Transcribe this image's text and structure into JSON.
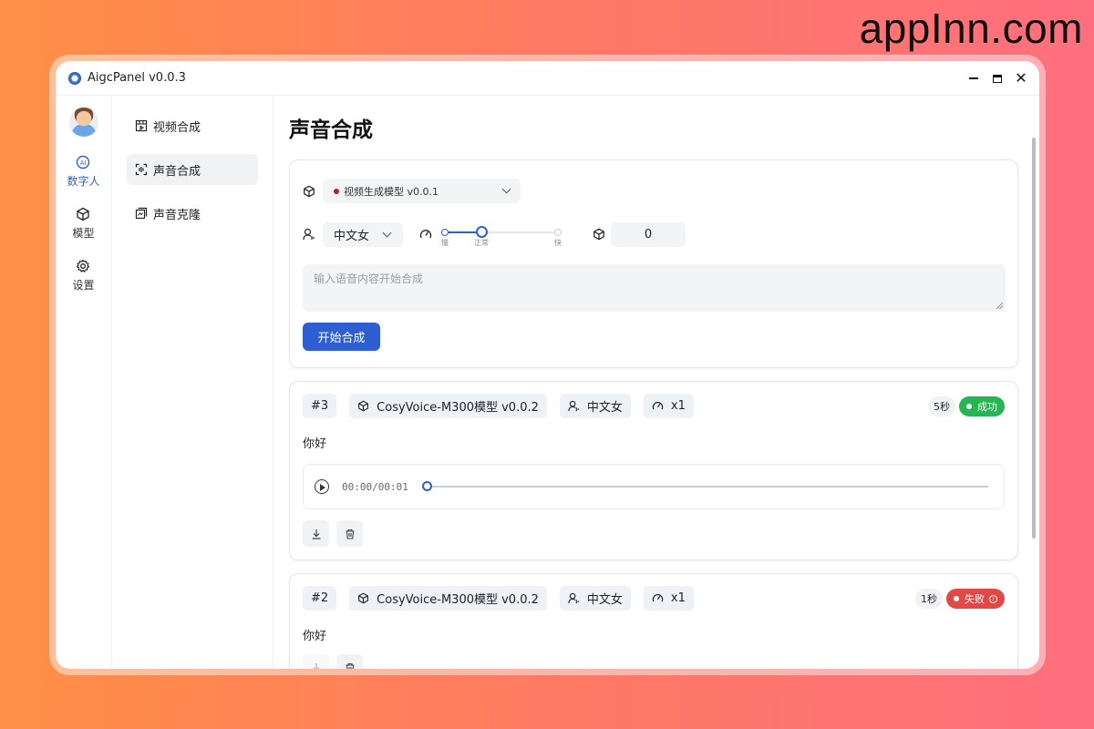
{
  "watermark": "appInn.com",
  "window": {
    "title": "AigcPanel v0.0.3"
  },
  "rail": {
    "items": [
      {
        "label": "数字人",
        "icon": "ai-icon",
        "active": true
      },
      {
        "label": "模型",
        "icon": "cube-icon",
        "active": false
      },
      {
        "label": "设置",
        "icon": "gear-icon",
        "active": false
      }
    ]
  },
  "subnav": {
    "items": [
      {
        "label": "视频合成",
        "icon": "video-icon"
      },
      {
        "label": "声音合成",
        "icon": "scan-icon",
        "active": true
      },
      {
        "label": "声音克隆",
        "icon": "copy-icon"
      }
    ]
  },
  "main": {
    "title": "声音合成",
    "form": {
      "model_value": "视频生成模型 v0.0.1",
      "voice_value": "中文女",
      "speed": {
        "value_fraction": 0.33,
        "labels": [
          "慢",
          "正常",
          "快"
        ]
      },
      "seed_value": "0",
      "text_placeholder": "输入语音内容开始合成",
      "submit_label": "开始合成"
    },
    "tasks": [
      {
        "id": "#3",
        "model": "CosyVoice-M300模型 v0.0.2",
        "voice": "中文女",
        "speed": "x1",
        "duration": "5秒",
        "status": "成功",
        "status_type": "success",
        "text": "你好",
        "player_time": "00:00/00:01"
      },
      {
        "id": "#2",
        "model": "CosyVoice-M300模型 v0.0.2",
        "voice": "中文女",
        "speed": "x1",
        "duration": "1秒",
        "status": "失败",
        "status_type": "fail",
        "text": "你好"
      }
    ]
  },
  "colors": {
    "accent": "#2d5fd3",
    "success": "#25b553",
    "fail": "#e14848"
  }
}
